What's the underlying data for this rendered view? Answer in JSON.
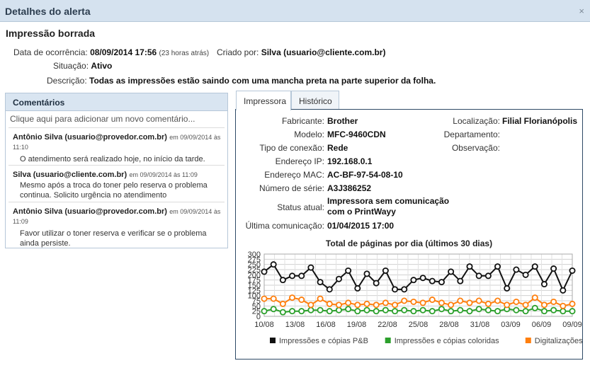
{
  "dialog": {
    "title": "Detalhes do alerta",
    "close": "×"
  },
  "alert": {
    "name": "Impressão borrada",
    "date_label": "Data de ocorrência:",
    "date_value": "08/09/2014 17:56",
    "date_ago": "(23 horas atrás)",
    "created_label": "Criado por:",
    "created_value": "Silva (usuario@cliente.com.br)",
    "status_label": "Situação:",
    "status_value": "Ativo",
    "desc_label": "Descrição:",
    "desc_value": "Todas as impressões estão saindo com uma mancha preta na parte superior da folha."
  },
  "comments": {
    "header": "Comentários",
    "add_placeholder": "Clique aqui para adicionar um novo comentário...",
    "items": [
      {
        "author": "Antônio Silva (usuario@provedor.com.br)",
        "date": "em 09/09/2014 às 11:10",
        "text": "O atendimento será realizado hoje, no início da tarde."
      },
      {
        "author": "Silva (usuario@cliente.com.br)",
        "date": "em 09/09/2014 às 11:09",
        "text": "Mesmo após a troca do toner pelo reserva o problema continua. Solicito urgência no atendimento"
      },
      {
        "author": "Antônio Silva (usuario@provedor.com.br)",
        "date": "em 09/09/2014 às 11:09",
        "text": "Favor utilizar o toner reserva e verificar se o problema ainda persiste."
      }
    ]
  },
  "tabs": {
    "printer": "Impressora",
    "history": "Histórico"
  },
  "printer": {
    "fab_k": "Fabricante:",
    "fab_v": "Brother",
    "model_k": "Modelo:",
    "model_v": "MFC-9460CDN",
    "conn_k": "Tipo de conexão:",
    "conn_v": "Rede",
    "ip_k": "Endereço IP:",
    "ip_v": "192.168.0.1",
    "mac_k": "Endereço MAC:",
    "mac_v": "AC-BF-97-54-08-10",
    "serial_k": "Número de série:",
    "serial_v": "A3J386252",
    "status_k": "Status atual:",
    "status_v1": "Impressora sem comunicação",
    "status_v2": "com o PrintWayy",
    "last_k": "Última comunicação:",
    "last_v": "01/04/2015 17:00",
    "loc_k": "Localização:",
    "loc_v": "Filial Florianópolis",
    "dept_k": "Departamento:",
    "obs_k": "Observação:"
  },
  "colors": {
    "pb": "#111111",
    "color": "#2ca02c",
    "scan": "#ff7f0e"
  },
  "chart_data": {
    "type": "line",
    "title": "Total de páginas por dia (últimos 30 dias)",
    "x": [
      "10/08",
      "11/08",
      "12/08",
      "13/08",
      "14/08",
      "15/08",
      "16/08",
      "17/08",
      "18/08",
      "19/08",
      "20/08",
      "21/08",
      "22/08",
      "23/08",
      "24/08",
      "25/08",
      "26/08",
      "27/08",
      "28/08",
      "29/08",
      "30/08",
      "31/08",
      "01/09",
      "02/09",
      "03/09",
      "04/09",
      "05/09",
      "06/09",
      "07/09",
      "08/09",
      "09/09"
    ],
    "xticks": [
      "10/08",
      "13/08",
      "16/08",
      "19/08",
      "22/08",
      "25/08",
      "28/08",
      "31/08",
      "03/09",
      "06/09",
      "09/09"
    ],
    "ylim": [
      0,
      300
    ],
    "yticks": [
      0,
      25,
      50,
      75,
      100,
      125,
      150,
      175,
      200,
      225,
      250,
      275,
      300
    ],
    "legend_position": "bottom",
    "series": [
      {
        "name": "Impressões e cópias P&B",
        "color": "#111111",
        "values": [
          215,
          250,
          175,
          195,
          195,
          235,
          165,
          130,
          180,
          220,
          135,
          205,
          160,
          220,
          130,
          130,
          175,
          185,
          170,
          165,
          215,
          170,
          240,
          195,
          195,
          240,
          135,
          225,
          200,
          240,
          155,
          230,
          125,
          220
        ]
      },
      {
        "name": "Impressões e cópias coloridas",
        "color": "#2ca02c",
        "values": [
          25,
          35,
          20,
          25,
          25,
          30,
          30,
          25,
          30,
          35,
          25,
          30,
          25,
          30,
          25,
          30,
          25,
          30,
          25,
          35,
          25,
          30,
          25,
          35,
          30,
          25,
          35,
          30,
          25,
          40,
          25,
          30,
          25,
          25
        ]
      },
      {
        "name": "Digitalizações",
        "color": "#ff7f0e",
        "values": [
          85,
          85,
          60,
          90,
          80,
          55,
          85,
          60,
          55,
          65,
          55,
          60,
          55,
          65,
          55,
          75,
          70,
          65,
          80,
          65,
          55,
          75,
          65,
          75,
          60,
          75,
          55,
          70,
          55,
          90,
          55,
          70,
          50,
          60
        ]
      }
    ]
  }
}
